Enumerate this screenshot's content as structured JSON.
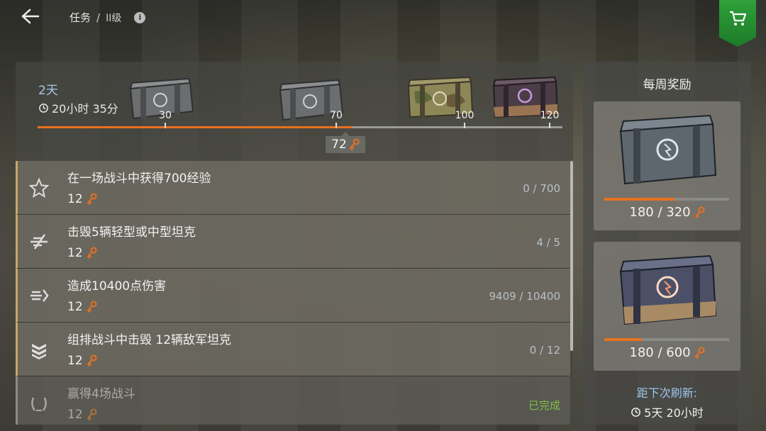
{
  "header": {
    "breadcrumb_root": "任务",
    "breadcrumb_sep": "/",
    "breadcrumb_level": "II级",
    "info_icon": "i"
  },
  "timer": {
    "days": "2天",
    "time": "20小时 35分"
  },
  "track": {
    "max": 120,
    "current": 72,
    "milestones": [
      {
        "value": "30",
        "crate": "gray-crate"
      },
      {
        "value": "70",
        "crate": "gray-crate"
      },
      {
        "value": "100",
        "crate": "camo-crate"
      },
      {
        "value": "120",
        "crate": "violet-crate"
      }
    ],
    "current_label": "72"
  },
  "tasks": [
    {
      "title": "在一场战斗中获得700经验",
      "reward": "12",
      "progress": "0 / 700",
      "icon": "star-icon",
      "done": false
    },
    {
      "title": "击毁5辆轻型或中型坦克",
      "reward": "12",
      "progress": "4 / 5",
      "icon": "destroy-tank-icon",
      "done": false
    },
    {
      "title": "造成10400点伤害",
      "reward": "12",
      "progress": "9409 / 10400",
      "icon": "damage-icon",
      "done": false
    },
    {
      "title": "组排战斗中击毁 12辆敌军坦克",
      "reward": "12",
      "progress": "0 / 12",
      "icon": "platoon-chevron-icon",
      "done": false
    },
    {
      "title": "赢得4场战斗",
      "reward": "12",
      "progress": "已完成",
      "icon": "laurel-icon",
      "done": true
    }
  ],
  "weekly": {
    "title": "每周奖励",
    "cards": [
      {
        "count": "180 / 320",
        "progress": 0.5625
      },
      {
        "count": "180 / 600",
        "progress": 0.3
      }
    ],
    "refresh_label": "距下次刷新:",
    "refresh_time": "5天 20小时"
  },
  "colors": {
    "accent_orange": "#e8711f",
    "done_green": "#7fbf4a",
    "shop_green": "#2fa13a",
    "timer_blue": "#a8c8e6"
  }
}
